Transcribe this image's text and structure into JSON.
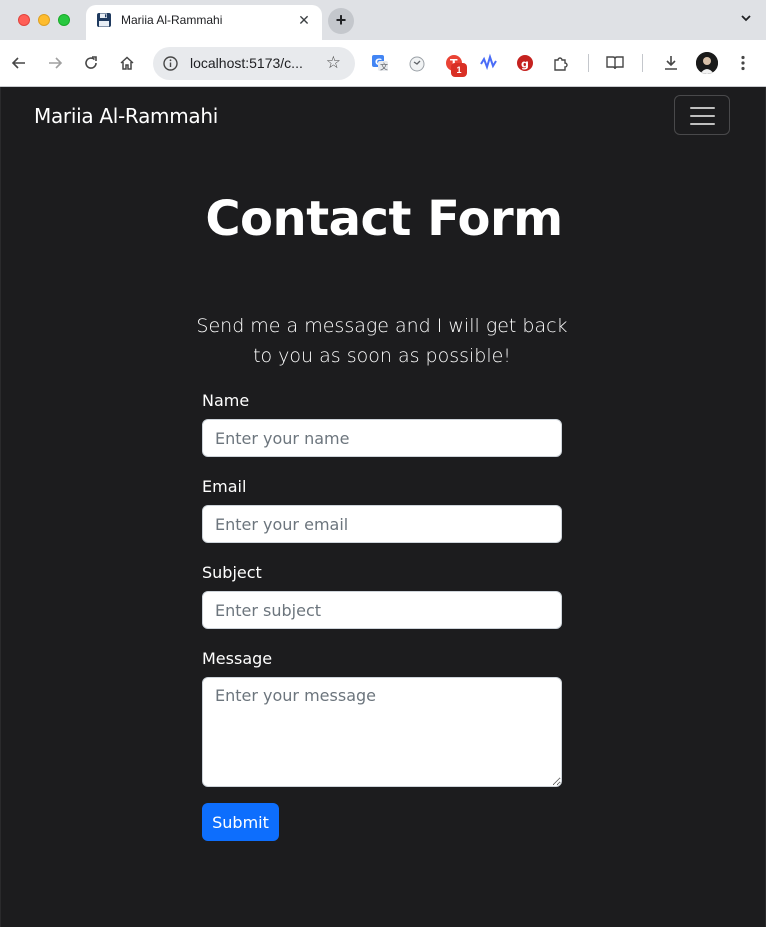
{
  "browser": {
    "tab_title": "Mariia Al-Rammahi",
    "tab_close": "✕",
    "new_tab": "+",
    "url": "localhost:5173/c...",
    "extension_badge": "1",
    "icons": [
      "back-icon",
      "forward-icon",
      "reload-icon",
      "home-icon",
      "site-info-icon",
      "bookmark-star-icon",
      "google-translate-icon",
      "extension-icon",
      "extension-icon",
      "extension-icon",
      "extension-icon",
      "puzzle-icon",
      "reading-list-icon",
      "download-icon",
      "avatar",
      "more-menu-icon"
    ]
  },
  "navbar": {
    "brand": "Mariia Al-Rammahi"
  },
  "main": {
    "title": "Contact Form",
    "lead": "Send me a message and I will get back to you as soon as possible!"
  },
  "form": {
    "name_label": "Name",
    "name_placeholder": "Enter your name",
    "email_label": "Email",
    "email_placeholder": "Enter your email",
    "subject_label": "Subject",
    "subject_placeholder": "Enter subject",
    "message_label": "Message",
    "message_placeholder": "Enter your message",
    "submit_label": "Submit"
  },
  "colors": {
    "page_background": "#1c1c1e",
    "primary_button": "#0d6efd"
  }
}
